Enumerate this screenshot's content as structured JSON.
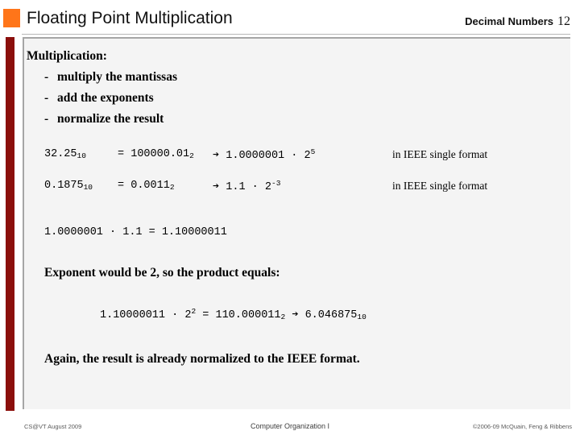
{
  "header": {
    "title": "Floating Point Multiplication",
    "topic": "Decimal Numbers",
    "slide_number": "12",
    "accent_color": "#ff7519",
    "rule_color": "#b8b8b8"
  },
  "decor": {
    "left_bar_color": "#8b0f0b",
    "panel_background": "#f4f4f4",
    "panel_border_color": "#a6a6a6"
  },
  "body": {
    "lead_line": "Multiplication:",
    "bullets": [
      {
        "dash": "-",
        "text": "multiply the mantissas"
      },
      {
        "dash": "-",
        "text": "add the exponents"
      },
      {
        "dash": "-",
        "text": "normalize the result"
      }
    ],
    "equations": [
      {
        "lhs_value": "32.25",
        "lhs_sub": "10",
        "equals": "=",
        "mid_value": "100000.01",
        "mid_sub": "2",
        "arrow": "➔",
        "mantissa": "1.0000001",
        "dot": "·",
        "base": "2",
        "exponent": "5",
        "note": "in IEEE single format"
      },
      {
        "lhs_value": "0.1875",
        "lhs_sub": "10",
        "equals": "=",
        "mid_value": "0.0011",
        "mid_sub": "2",
        "arrow": "➔",
        "mantissa": "1.1",
        "dot": "·",
        "base": "2",
        "exponent": "-3",
        "note": "in IEEE single format"
      }
    ],
    "product_line": "1.0000001 · 1.1 = 1.10000011",
    "exponent_note": "Exponent would be 2, so the product equals:",
    "final_equation": {
      "mantissa": "1.10000011",
      "dot": "·",
      "base": "2",
      "exponent": "2",
      "equals": "=",
      "result_binary": "110.000011",
      "result_binary_sub": "2",
      "arrow": "➔",
      "result_decimal": "6.046875",
      "result_decimal_sub": "10"
    },
    "closing_note": "Again, the result is already normalized to the IEEE format."
  },
  "footer": {
    "left": "CS@VT August 2009",
    "center": "Computer Organization I",
    "right": "©2006-09 McQuain, Feng & Ribbens"
  }
}
